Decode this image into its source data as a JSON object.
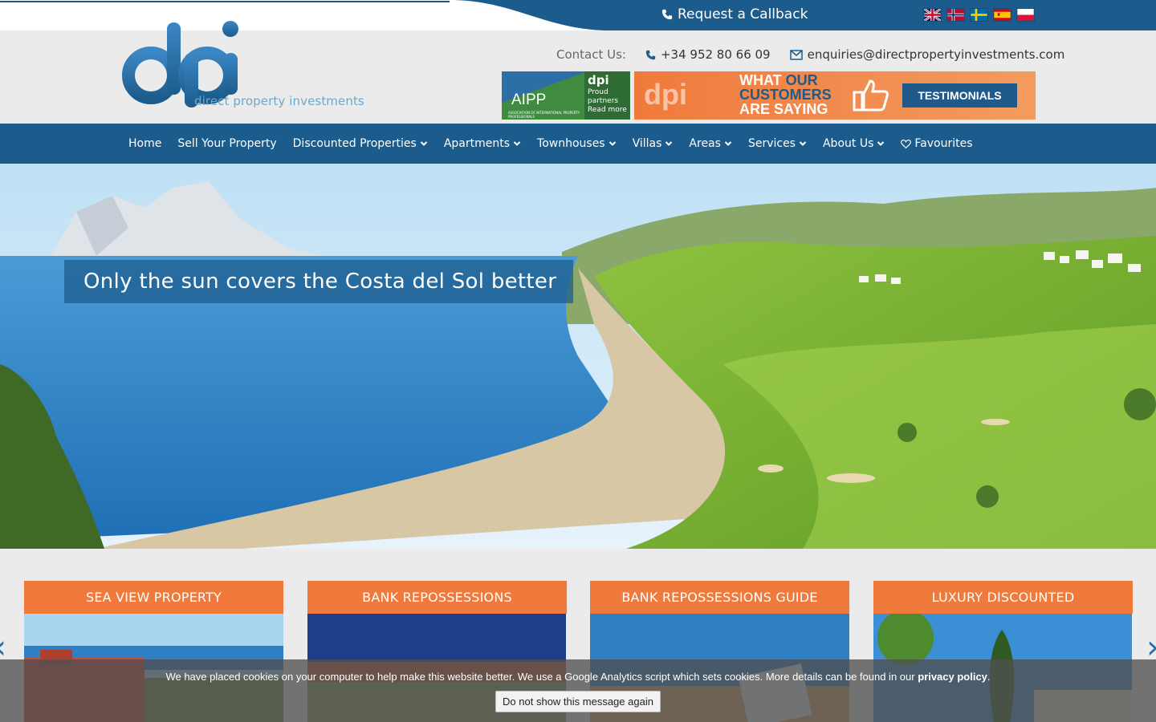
{
  "topbar": {
    "callback_label": "Request a Callback",
    "flags": [
      {
        "name": "english",
        "colors": [
          "#012169",
          "#ffffff",
          "#c8102e"
        ]
      },
      {
        "name": "norwegian",
        "colors": [
          "#ba0c2f",
          "#ffffff",
          "#00205b"
        ]
      },
      {
        "name": "swedish",
        "colors": [
          "#006aa7",
          "#fecc00"
        ]
      },
      {
        "name": "spanish",
        "colors": [
          "#c60b1e",
          "#ffc400"
        ]
      },
      {
        "name": "polish",
        "colors": [
          "#ffffff",
          "#dc143c"
        ]
      }
    ]
  },
  "logo": {
    "brand": "dpi",
    "subtitle": "direct property investments"
  },
  "contact": {
    "label": "Contact Us:",
    "phone": "+34 952 80 66 09",
    "email": "enquiries@directpropertyinvestments.com"
  },
  "banners": {
    "aipp": {
      "title": "AIPP",
      "small": "ASSOCIATION OF INTERNATIONAL PROPERTY PROFESSIONALS",
      "brand": "dpi",
      "text_lines": [
        "Proud",
        "partners",
        "Read more"
      ]
    },
    "testimonials": {
      "brand": "dpi",
      "line1_a": "WHAT ",
      "line1_b": "OUR",
      "line2": "CUSTOMERS",
      "line3": "ARE SAYING",
      "button": "TESTIMONIALS"
    }
  },
  "nav": {
    "items": [
      {
        "label": "Home",
        "dropdown": false
      },
      {
        "label": "Sell Your Property",
        "dropdown": false
      },
      {
        "label": "Discounted Properties",
        "dropdown": true
      },
      {
        "label": "Apartments",
        "dropdown": true
      },
      {
        "label": "Townhouses",
        "dropdown": true
      },
      {
        "label": "Villas",
        "dropdown": true
      },
      {
        "label": "Areas",
        "dropdown": true
      },
      {
        "label": "Services",
        "dropdown": true
      },
      {
        "label": "About Us",
        "dropdown": true
      },
      {
        "label": "Favourites",
        "dropdown": false,
        "icon": "heart-icon"
      }
    ]
  },
  "hero": {
    "slogan": "Only the sun covers the Costa del Sol better"
  },
  "cards": [
    {
      "title": "SEA VIEW PROPERTY"
    },
    {
      "title": "BANK REPOSSESSIONS"
    },
    {
      "title": "BANK REPOSSESSIONS GUIDE"
    },
    {
      "title": "LUXURY DISCOUNTED"
    }
  ],
  "cookie": {
    "message": "We have placed cookies on your computer to help make this website better. We use a Google Analytics script which sets cookies. More details can be found in our ",
    "link": "privacy policy",
    "after": ".",
    "button": "Do not show this message again"
  },
  "colors": {
    "primary": "#1c5c8d",
    "accent": "#f07a3c"
  }
}
